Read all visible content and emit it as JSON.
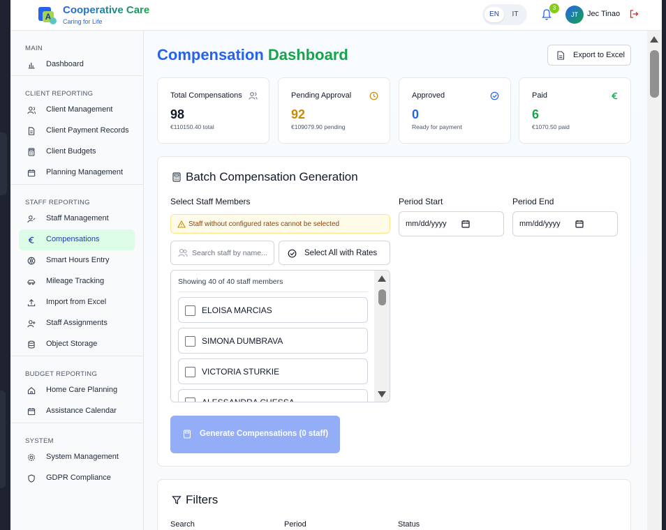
{
  "brand": {
    "title": "Cooperative Care",
    "subtitle": "Caring for Life",
    "logo_letter": "A"
  },
  "header": {
    "languages": [
      "EN",
      "IT"
    ],
    "active_language": "EN",
    "notifications_count": "3",
    "user_initials": "JT",
    "user_name": "Jec Tinao"
  },
  "sidebar": {
    "sections": [
      {
        "label": "MAIN",
        "items": [
          {
            "label": "Dashboard",
            "icon": "bar-chart-icon"
          }
        ]
      },
      {
        "label": "CLIENT REPORTING",
        "items": [
          {
            "label": "Client Management",
            "icon": "users-icon"
          },
          {
            "label": "Client Payment Records",
            "icon": "document-icon"
          },
          {
            "label": "Client Budgets",
            "icon": "calculator-icon"
          },
          {
            "label": "Planning Management",
            "icon": "calendar-icon"
          }
        ]
      },
      {
        "label": "STAFF REPORTING",
        "items": [
          {
            "label": "Staff Management",
            "icon": "user-cog-icon"
          },
          {
            "label": "Compensations",
            "icon": "euro-icon",
            "active": true
          },
          {
            "label": "Smart Hours Entry",
            "icon": "sparkle-icon"
          },
          {
            "label": "Mileage Tracking",
            "icon": "car-icon"
          },
          {
            "label": "Import from Excel",
            "icon": "upload-icon"
          },
          {
            "label": "Staff Assignments",
            "icon": "user-plus-icon"
          },
          {
            "label": "Object Storage",
            "icon": "database-icon"
          }
        ]
      },
      {
        "label": "BUDGET REPORTING",
        "items": [
          {
            "label": "Home Care Planning",
            "icon": "home-icon"
          },
          {
            "label": "Assistance Calendar",
            "icon": "calendar-icon"
          }
        ]
      },
      {
        "label": "SYSTEM",
        "items": [
          {
            "label": "System Management",
            "icon": "gear-icon"
          },
          {
            "label": "GDPR Compliance",
            "icon": "shield-icon"
          }
        ]
      }
    ]
  },
  "page": {
    "title_part1": "Compensation",
    "title_part2": "Dashboard",
    "export_label": "Export to Excel"
  },
  "stats": [
    {
      "title": "Total Compensations",
      "value": "98",
      "sub": "€110150.40 total",
      "icon": "users-icon",
      "color": "#111827"
    },
    {
      "title": "Pending Approval",
      "value": "92",
      "sub": "€109079.90 pending",
      "icon": "clock-icon",
      "color": "#ca8a04"
    },
    {
      "title": "Approved",
      "value": "0",
      "sub": "Ready for payment",
      "icon": "check-circle-icon",
      "color": "#2563eb"
    },
    {
      "title": "Paid",
      "value": "6",
      "sub": "€1070.50 paid",
      "icon": "euro-icon",
      "color": "#16a34a"
    }
  ],
  "batch": {
    "title": "Batch Compensation Generation",
    "select_staff_label": "Select Staff Members",
    "warning": "Staff without configured rates cannot be selected",
    "period_start_label": "Period Start",
    "period_end_label": "Period End",
    "period_start_value": "mm/dd/yyyy",
    "period_end_value": "mm/dd/yyyy",
    "search_placeholder": "Search staff by name...",
    "select_all_label": "Select All with Rates",
    "showing_text": "Showing 40 of 40 staff members",
    "staff": [
      "ELOISA MARCIAS",
      "SIMONA DUMBRAVA",
      "VICTORIA STURKIE",
      "ALESSANDRA CHESSA"
    ],
    "generate_label": "Generate Compensations (0 staff)"
  },
  "filters": {
    "title": "Filters",
    "labels": [
      "Search",
      "Period",
      "Status"
    ]
  }
}
